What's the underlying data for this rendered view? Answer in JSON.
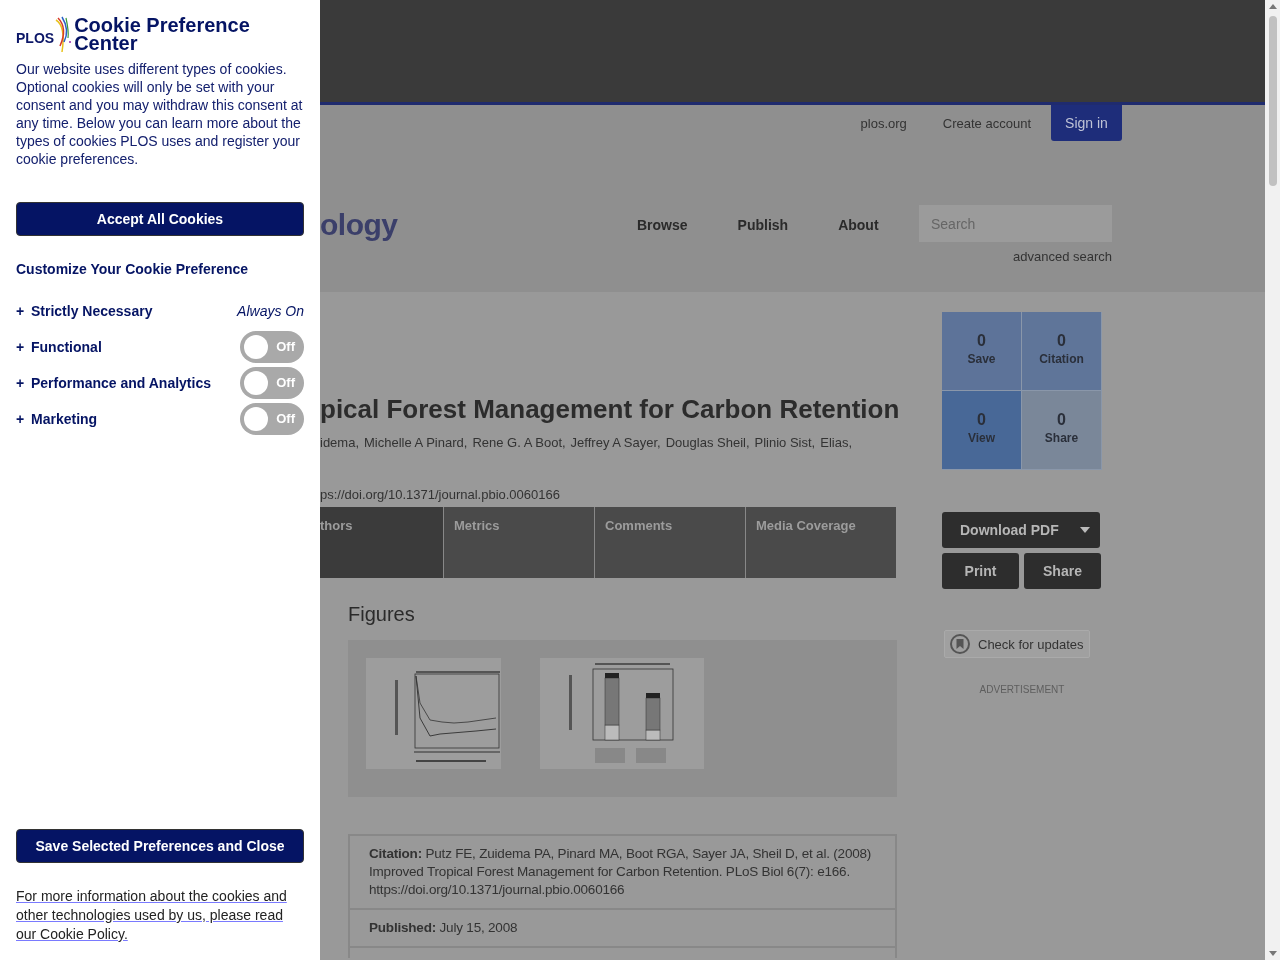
{
  "cookie_panel": {
    "logo": "PLOS",
    "title": "Cookie Preference Center",
    "description": "Our website uses different types of cookies. Optional cookies will only be set with your consent and you may withdraw this consent at any time. Below you can learn more about the types of cookies PLOS uses and register your cookie preferences.",
    "accept_button": "Accept All Cookies",
    "customize_heading": "Customize Your Cookie Preference",
    "categories": [
      {
        "label": "Strictly Necessary",
        "kind": "fixed",
        "status": "Always On"
      },
      {
        "label": "Functional",
        "kind": "toggle",
        "on": false,
        "toggle_label": "Off"
      },
      {
        "label": "Performance and Analytics",
        "kind": "toggle",
        "on": false,
        "toggle_label": "Off"
      },
      {
        "label": "Marketing",
        "kind": "toggle",
        "on": false,
        "toggle_label": "Off"
      }
    ],
    "expand_marker": "+",
    "save_button": "Save Selected Preferences and Close",
    "policy_link": "For more information about the cookies and other technologies used by us, please read our Cookie Policy."
  },
  "page": {
    "top_links": [
      "plos.org",
      "Create account"
    ],
    "sign_in": "Sign in",
    "site_logo": "ology",
    "nav": [
      "Browse",
      "Publish",
      "About"
    ],
    "search": {
      "placeholder": "Search"
    },
    "advanced_search": "advanced search",
    "article": {
      "title": "pical Forest Management for Carbon Retention",
      "authors": [
        "idema,",
        "Michelle A Pinard,",
        "Rene G. A Boot,",
        "Jeffrey A Sayer,",
        "Douglas Sheil,",
        "Plinio Sist,",
        "Elias,"
      ],
      "doi": "ps://doi.org/10.1371/journal.pbio.0060166",
      "tabs": [
        {
          "label": "thors",
          "selected": true
        },
        {
          "label": "Metrics",
          "selected": false
        },
        {
          "label": "Comments",
          "selected": false
        },
        {
          "label": "Media Coverage",
          "selected": false
        }
      ],
      "figures_heading": "Figures",
      "citation": {
        "label": "Citation:",
        "text": "Putz FE, Zuidema PA, Pinard MA, Boot RGA, Sayer JA, Sheil D, et al. (2008) Improved Tropical Forest Management for Carbon Retention. PLoS Biol 6(7): e166. https://doi.org/10.1371/journal.pbio.0060166"
      },
      "published": {
        "label": "Published:",
        "text": "July 15, 2008"
      }
    },
    "metrics": [
      {
        "count": "0",
        "label": "Save",
        "color": "#5d7399"
      },
      {
        "count": "0",
        "label": "Citation",
        "color": "#5f7599"
      },
      {
        "count": "0",
        "label": "View",
        "color": "#486897"
      },
      {
        "count": "0",
        "label": "Share",
        "color": "#7a8799"
      }
    ],
    "download_pdf": "Download PDF",
    "actions": [
      "Print",
      "Share"
    ],
    "check_updates": "Check for updates",
    "advertisement": "ADVERTISEMENT"
  }
}
